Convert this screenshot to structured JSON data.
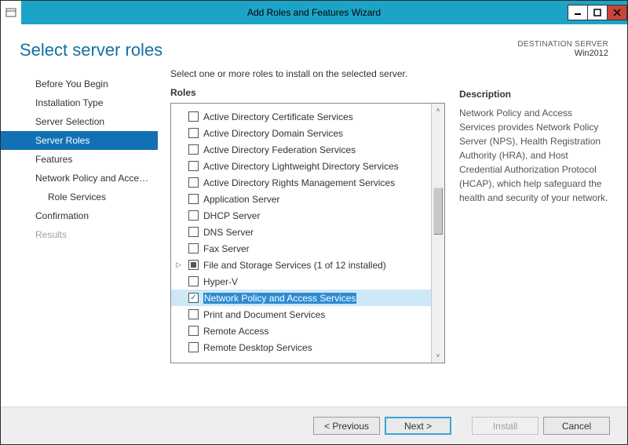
{
  "titlebar": {
    "title": "Add Roles and Features Wizard"
  },
  "header": {
    "page_title": "Select server roles",
    "dest_label": "DESTINATION SERVER",
    "dest_value": "Win2012"
  },
  "sidebar": {
    "items": [
      {
        "label": "Before You Begin",
        "selected": false,
        "disabled": false,
        "indent": false
      },
      {
        "label": "Installation Type",
        "selected": false,
        "disabled": false,
        "indent": false
      },
      {
        "label": "Server Selection",
        "selected": false,
        "disabled": false,
        "indent": false
      },
      {
        "label": "Server Roles",
        "selected": true,
        "disabled": false,
        "indent": false
      },
      {
        "label": "Features",
        "selected": false,
        "disabled": false,
        "indent": false
      },
      {
        "label": "Network Policy and Acces...",
        "selected": false,
        "disabled": false,
        "indent": false
      },
      {
        "label": "Role Services",
        "selected": false,
        "disabled": false,
        "indent": true
      },
      {
        "label": "Confirmation",
        "selected": false,
        "disabled": false,
        "indent": false
      },
      {
        "label": "Results",
        "selected": false,
        "disabled": true,
        "indent": false
      }
    ]
  },
  "main": {
    "instruction": "Select one or more roles to install on the selected server.",
    "roles_header": "Roles",
    "roles": [
      {
        "label": "Active Directory Certificate Services",
        "state": "unchecked",
        "expand": false,
        "selected": false
      },
      {
        "label": "Active Directory Domain Services",
        "state": "unchecked",
        "expand": false,
        "selected": false
      },
      {
        "label": "Active Directory Federation Services",
        "state": "unchecked",
        "expand": false,
        "selected": false
      },
      {
        "label": "Active Directory Lightweight Directory Services",
        "state": "unchecked",
        "expand": false,
        "selected": false
      },
      {
        "label": "Active Directory Rights Management Services",
        "state": "unchecked",
        "expand": false,
        "selected": false
      },
      {
        "label": "Application Server",
        "state": "unchecked",
        "expand": false,
        "selected": false
      },
      {
        "label": "DHCP Server",
        "state": "unchecked",
        "expand": false,
        "selected": false
      },
      {
        "label": "DNS Server",
        "state": "unchecked",
        "expand": false,
        "selected": false
      },
      {
        "label": "Fax Server",
        "state": "unchecked",
        "expand": false,
        "selected": false
      },
      {
        "label": "File and Storage Services (1 of 12 installed)",
        "state": "partial",
        "expand": true,
        "selected": false
      },
      {
        "label": "Hyper-V",
        "state": "unchecked",
        "expand": false,
        "selected": false
      },
      {
        "label": "Network Policy and Access Services",
        "state": "checked",
        "expand": false,
        "selected": true
      },
      {
        "label": "Print and Document Services",
        "state": "unchecked",
        "expand": false,
        "selected": false
      },
      {
        "label": "Remote Access",
        "state": "unchecked",
        "expand": false,
        "selected": false
      },
      {
        "label": "Remote Desktop Services",
        "state": "unchecked",
        "expand": false,
        "selected": false
      }
    ],
    "desc_header": "Description",
    "description": "Network Policy and Access Services provides Network Policy Server (NPS), Health Registration Authority (HRA), and Host Credential Authorization Protocol (HCAP), which help safeguard the health and security of your network."
  },
  "buttons": {
    "previous": "< Previous",
    "next": "Next >",
    "install": "Install",
    "cancel": "Cancel"
  }
}
